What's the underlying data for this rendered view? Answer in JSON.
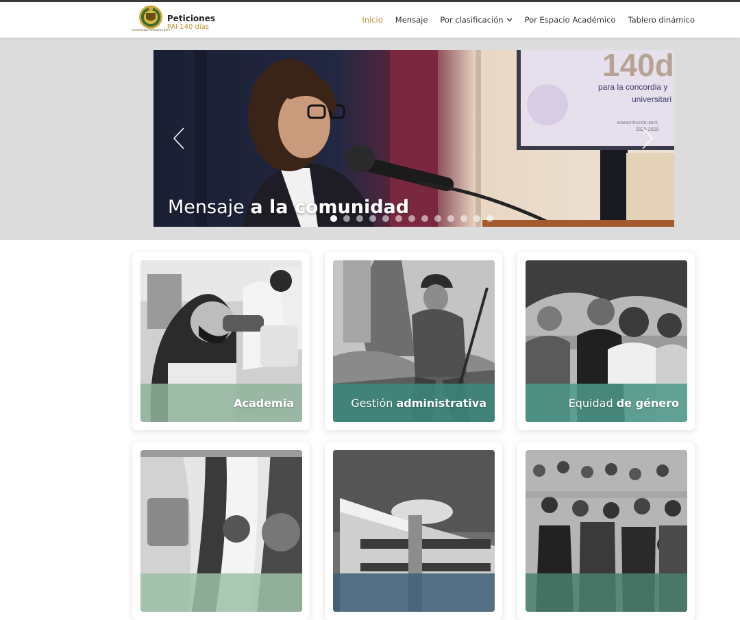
{
  "header": {
    "seal_caption": "Universidad Autónoma del Estado de México",
    "brand_title": "Peticiones",
    "brand_subtitle": "PAI 140 días",
    "nav": [
      {
        "label": "Inicio",
        "active": true
      },
      {
        "label": "Mensaje",
        "active": false
      },
      {
        "label": "Por clasificación",
        "active": false,
        "dropdown": true
      },
      {
        "label": "Por Espacio Académico",
        "active": false
      },
      {
        "label": "Tablero dinámico",
        "active": false
      }
    ]
  },
  "hero": {
    "caption_light": "Mensaje ",
    "caption_bold": "a la comunidad",
    "screen_number": "140d",
    "screen_line1": "para la concordia y",
    "screen_line2": "universitari",
    "screen_footer": "ADMINISTRACIÓN UNIVE",
    "screen_years": "2025-2029",
    "slide_count": 13,
    "active_slide": 1
  },
  "cards": [
    {
      "light": "",
      "bold": "Academia",
      "bar_color": "#8fb39b"
    },
    {
      "light": "Gestión ",
      "bold": "administrativa",
      "bar_color": "#3c8a7e"
    },
    {
      "light": "Equidad ",
      "bold": "de género",
      "bar_color": "#4e9a8a"
    },
    {
      "light": "",
      "bold": "",
      "bar_color": "#9cbfa6"
    },
    {
      "light": "",
      "bold": "",
      "bar_color": "#3f5f78"
    },
    {
      "light": "",
      "bold": "",
      "bar_color": "#4a7f6c"
    }
  ],
  "colors": {
    "accent": "#b8902e",
    "hero_band": "#dcdcdc"
  }
}
